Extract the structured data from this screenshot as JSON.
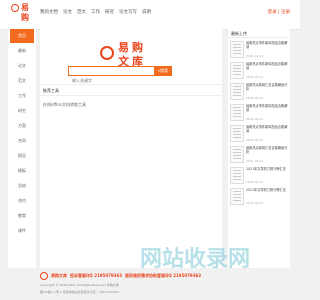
{
  "header": {
    "logo_char1": "易",
    "logo_char2": "购",
    "logo_char3": "文",
    "logo_char4": "库",
    "nav": [
      "我的文档",
      "论文",
      "范文",
      "工作",
      "研究",
      "论文写写",
      "说明"
    ],
    "login": "登录",
    "register": "注册"
  },
  "sidebar": {
    "items": [
      "首页",
      "最新",
      "论文",
      "范文",
      "工作",
      "研究",
      "方案",
      "合同",
      "报告",
      "模板",
      "总结",
      "合约",
      "教育",
      "课件"
    ]
  },
  "main": {
    "search_placeholder": "输入关键字",
    "search_button": "搜索",
    "section_title": "推荐工具",
    "section_desc": "在线office文档转换工具"
  },
  "right_panel": {
    "title": "最新上传",
    "items": [
      {
        "title": "最新热点事件新闻总结合集解读",
        "date": "2021-04-11"
      },
      {
        "title": "最新热点事件新闻总结合集解读",
        "date": "2021-04-11"
      },
      {
        "title": "最新热点新闻汇总合集解读分析",
        "date": "2021-04-11"
      },
      {
        "title": "最新热点事件新闻总结合集解读",
        "date": "2021-04-11"
      },
      {
        "title": "最新热点事件新闻总结合集解读",
        "date": "2021-04-11"
      },
      {
        "title": "最新热点新闻汇总合集解读分析",
        "date": "2021-04-11"
      },
      {
        "title": "2021年文章热门排行榜汇总",
        "date": "2021-04-11"
      },
      {
        "title": "2021年文章热门排行榜汇总",
        "date": "2021-04-11"
      }
    ]
  },
  "footer": {
    "brand": "易购文库",
    "qq1": "投诉客服QQ 2195079363",
    "qq2": "版权维权需求协助客服QQ 2195079363",
    "copyright": "Copyright © 2015-2021 All Rights Reserved 易购文库",
    "icp": "蜀ICP备××号-1  增值电信业务经营许可证：川B2-XXXXXX"
  },
  "watermark": "网站收录网",
  "colors": {
    "accent": "#f36b1f",
    "brand": "#e8461c"
  }
}
